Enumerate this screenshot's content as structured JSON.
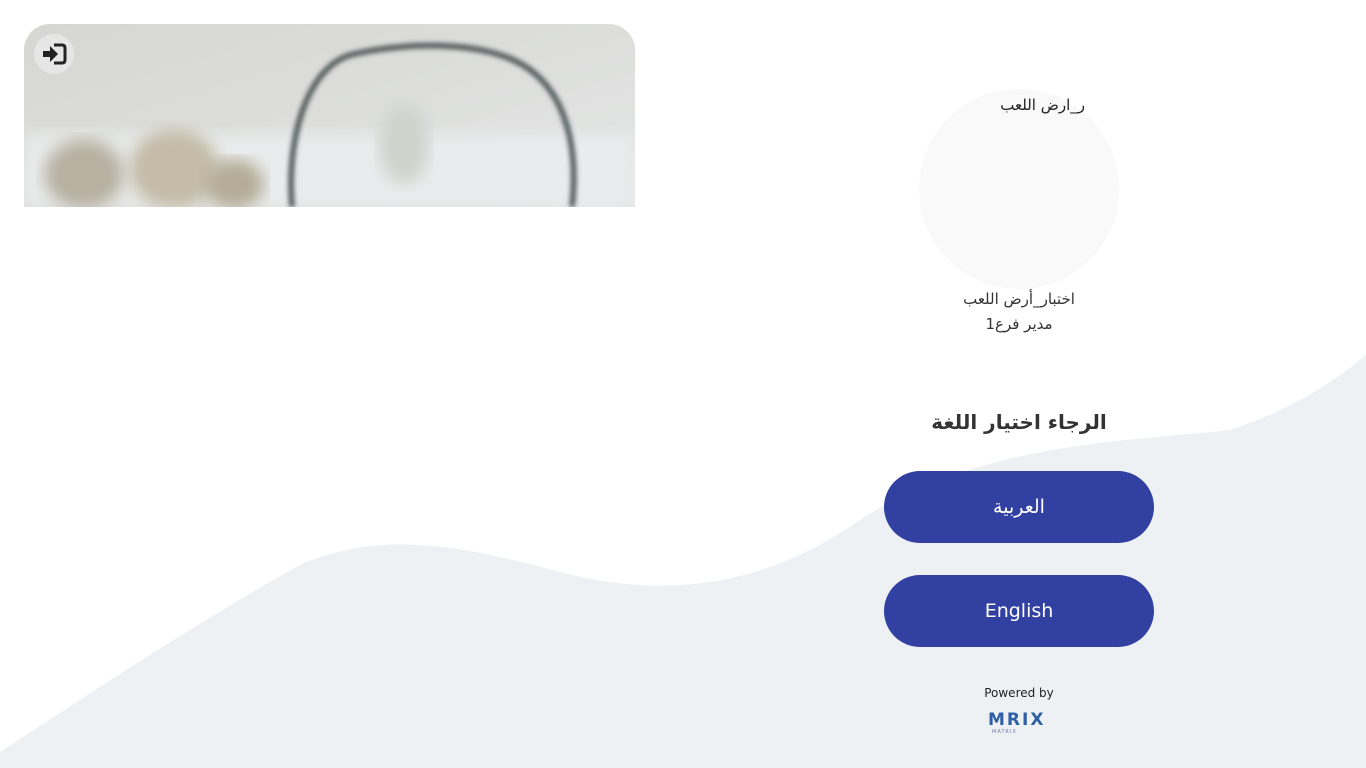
{
  "profile": {
    "avatar_alt": "ر_ارض اللعب",
    "name": "اختبار_أرض اللعب",
    "role": "مدير فرع1"
  },
  "language_prompt": "الرجاء اختيار اللغة",
  "languages": [
    {
      "label": "العربية"
    },
    {
      "label": "English"
    }
  ],
  "footer": {
    "powered_by": "Powered by",
    "brand_logo_text": "MRIX",
    "brand_logo_subtext": "MATRIX"
  },
  "icons": {
    "logout": "logout-icon"
  },
  "colors": {
    "primary_button": "#3240a2",
    "wave_background": "#eef1f4",
    "avatar_background": "#f9f9f9"
  }
}
